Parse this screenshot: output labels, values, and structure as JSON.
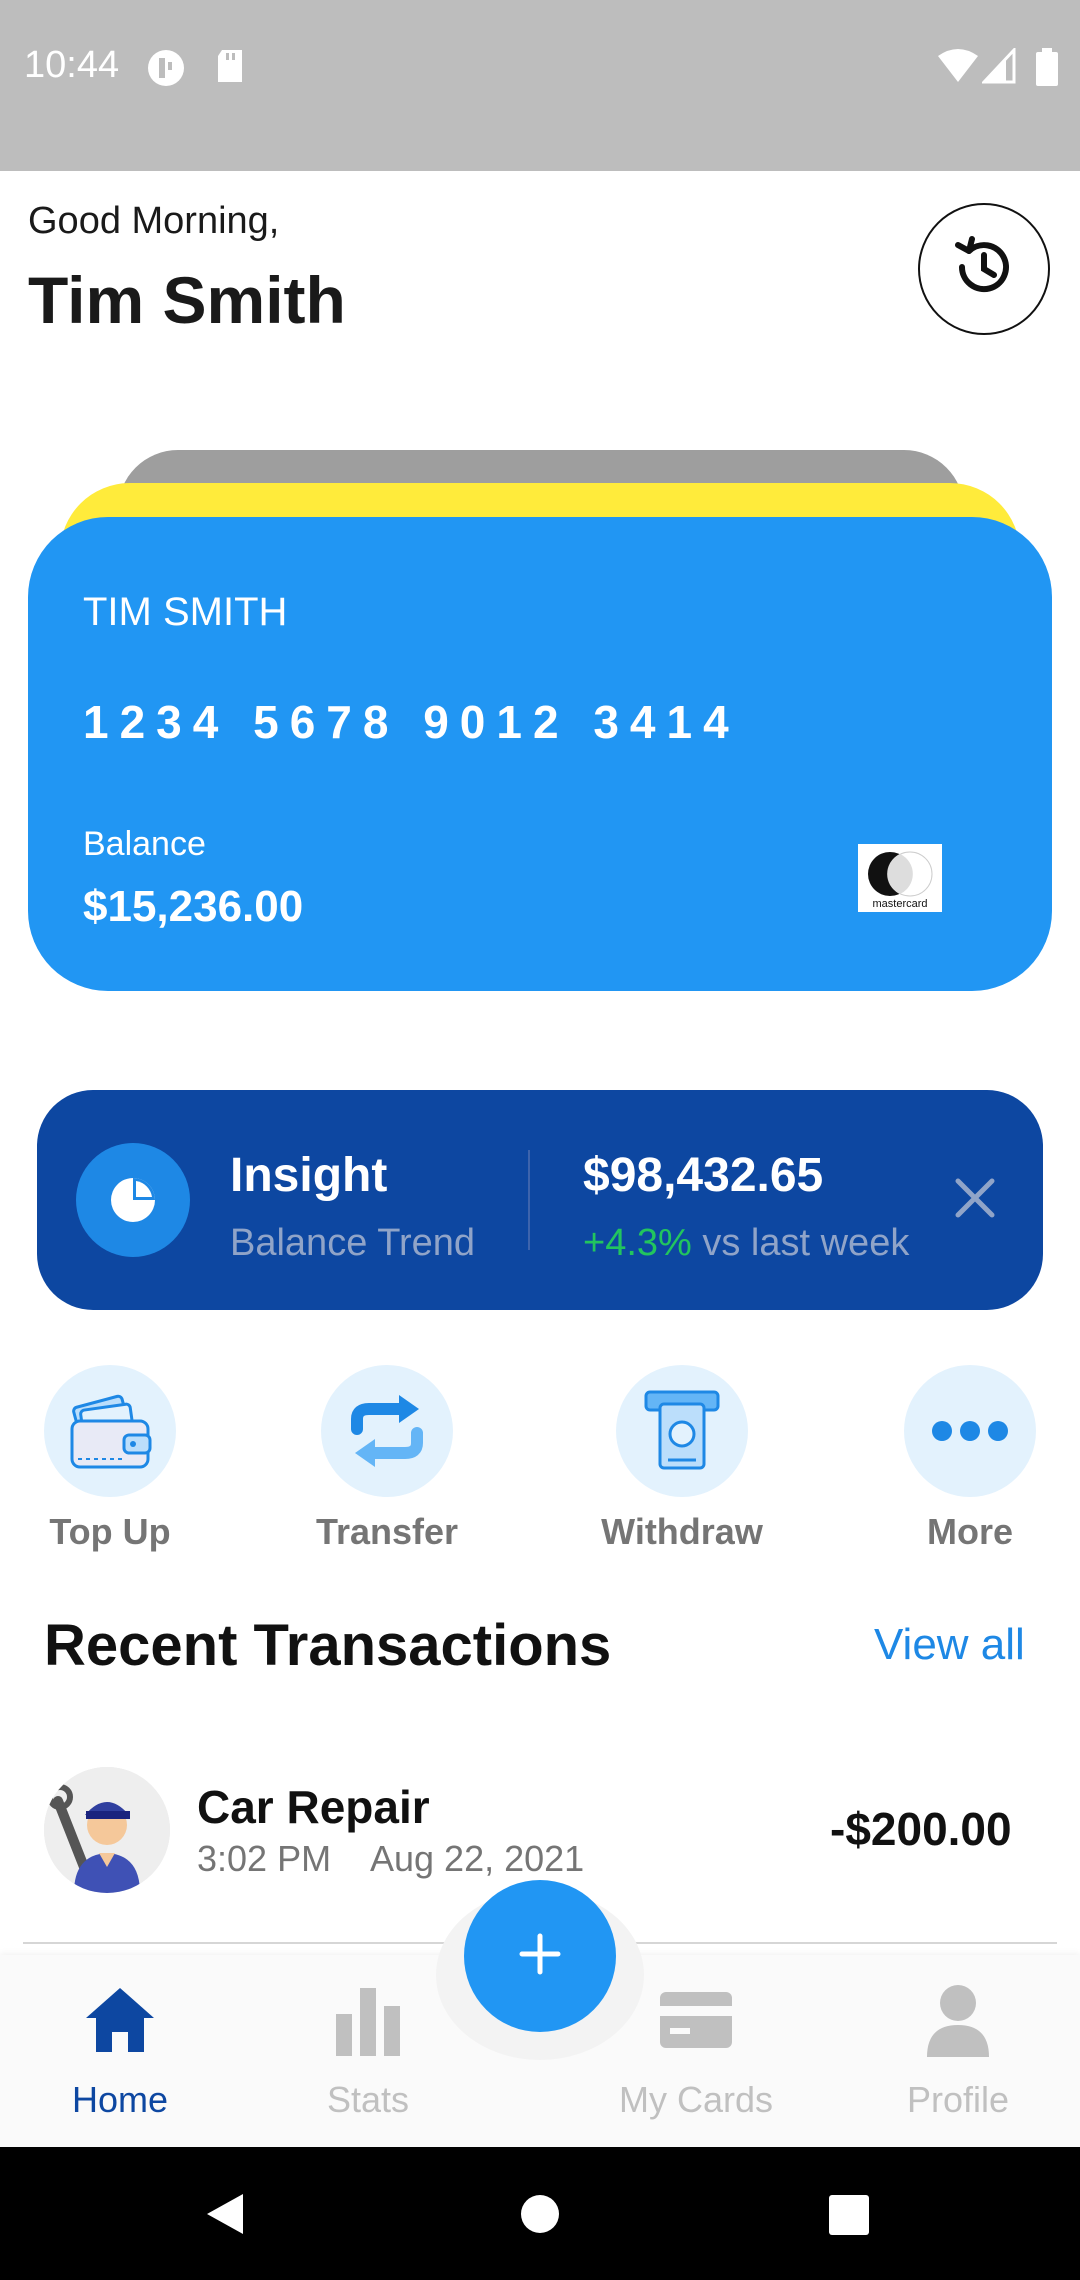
{
  "status_bar": {
    "time": "10:44"
  },
  "header": {
    "greeting": "Good Morning,",
    "user_name": "Tim Smith"
  },
  "card": {
    "holder": "TIM SMITH",
    "number": "1234 5678 9012 3414",
    "balance_label": "Balance",
    "balance": "$15,236.00",
    "brand_text": "mastercard"
  },
  "insight": {
    "title": "Insight",
    "subtitle": "Balance Trend",
    "amount": "$98,432.65",
    "change": "+4.3%",
    "change_suffix": " vs last week"
  },
  "actions": [
    {
      "label": "Top Up",
      "icon": "wallet-icon"
    },
    {
      "label": "Transfer",
      "icon": "transfer-icon"
    },
    {
      "label": "Withdraw",
      "icon": "atm-withdraw-icon"
    },
    {
      "label": "More",
      "icon": "more-dots-icon"
    }
  ],
  "recent": {
    "title": "Recent Transactions",
    "view_all": "View all",
    "items": [
      {
        "title": "Car Repair",
        "time": "3:02 PM",
        "date": "Aug 22, 2021",
        "amount": "-$200.00"
      }
    ]
  },
  "bottom_nav": {
    "items": [
      {
        "label": "Home",
        "active": true
      },
      {
        "label": "Stats",
        "active": false
      },
      {
        "label": "My Cards",
        "active": false
      },
      {
        "label": "Profile",
        "active": false
      }
    ]
  },
  "colors": {
    "primary": "#2196f3",
    "dark_blue": "#0d47a1",
    "accent_yellow": "#ffeb3b",
    "positive": "#22c55e"
  }
}
